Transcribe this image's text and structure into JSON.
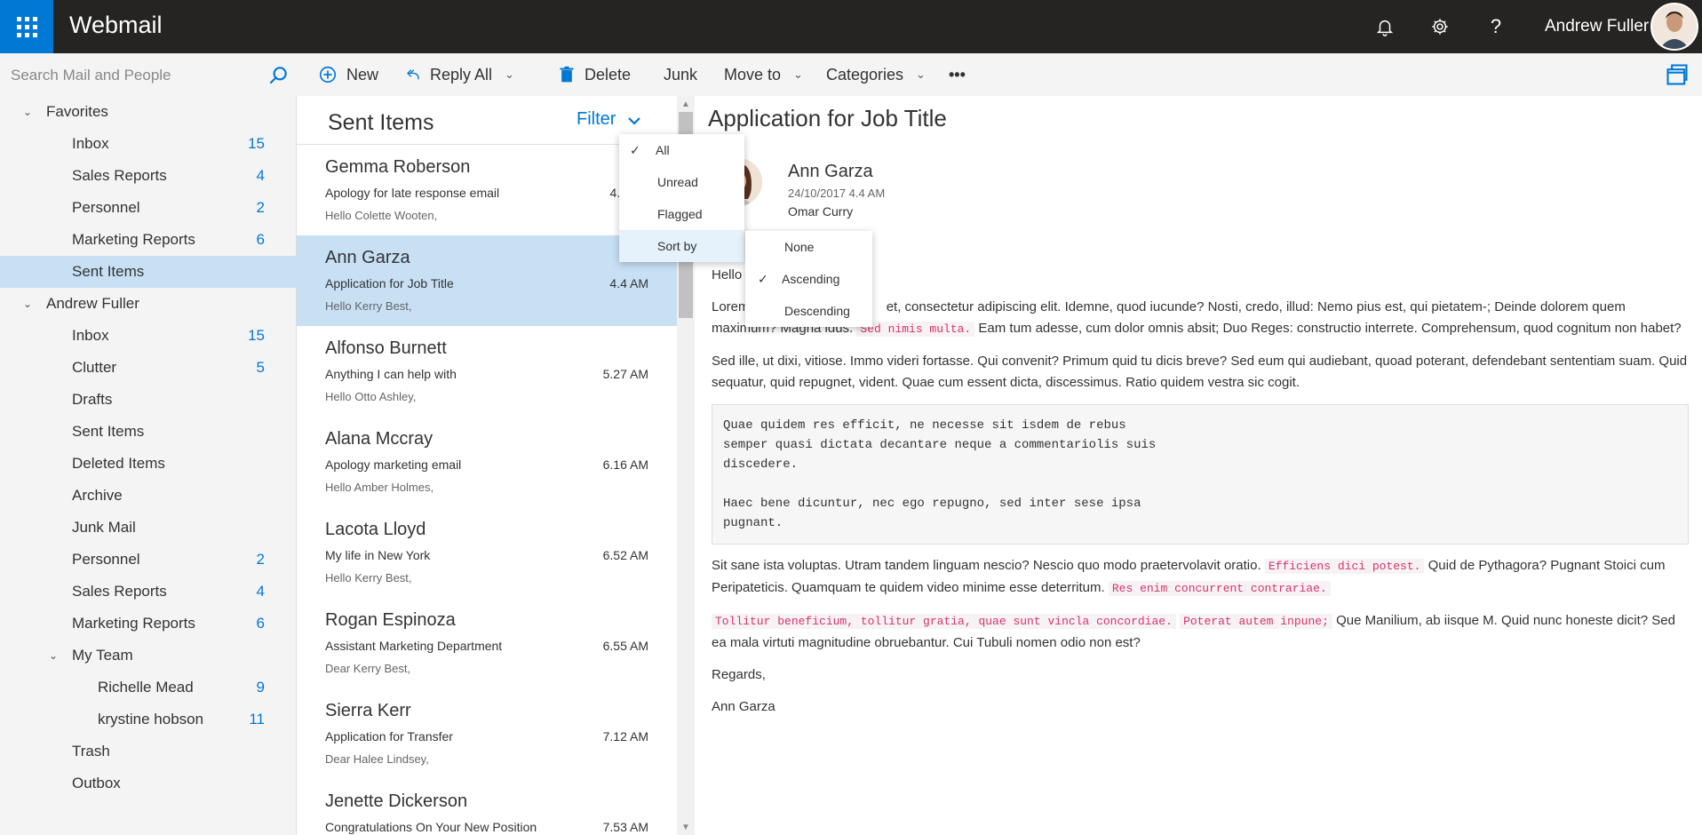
{
  "app": {
    "title": "Webmail",
    "user_name": "Andrew Fuller"
  },
  "topbar": {
    "icons": [
      "waffle-icon",
      "bell-icon",
      "gear-icon",
      "help-icon"
    ]
  },
  "search": {
    "placeholder": "Search Mail and People"
  },
  "sidebar": {
    "favorites": {
      "label": "Favorites",
      "items": [
        {
          "label": "Inbox",
          "count": "15"
        },
        {
          "label": "Sales Reports",
          "count": "4"
        },
        {
          "label": "Personnel",
          "count": "2"
        },
        {
          "label": "Marketing Reports",
          "count": "6"
        },
        {
          "label": "Sent Items",
          "count": ""
        }
      ]
    },
    "account": {
      "label": "Andrew Fuller",
      "items": [
        {
          "label": "Inbox",
          "count": "15"
        },
        {
          "label": "Clutter",
          "count": "5"
        },
        {
          "label": "Drafts",
          "count": ""
        },
        {
          "label": "Sent Items",
          "count": ""
        },
        {
          "label": "Deleted Items",
          "count": ""
        },
        {
          "label": "Archive",
          "count": ""
        },
        {
          "label": "Junk Mail",
          "count": ""
        },
        {
          "label": "Personnel",
          "count": "2"
        },
        {
          "label": "Sales Reports",
          "count": "4"
        },
        {
          "label": "Marketing Reports",
          "count": "6"
        }
      ],
      "team": {
        "label": "My Team",
        "items": [
          {
            "label": "Richelle Mead",
            "count": "9"
          },
          {
            "label": "krystine hobson",
            "count": "11"
          }
        ]
      },
      "after_team": [
        {
          "label": "Trash",
          "count": ""
        },
        {
          "label": "Outbox",
          "count": ""
        }
      ]
    }
  },
  "toolbar": {
    "new_label": "New",
    "reply_all_label": "Reply All",
    "delete_label": "Delete",
    "junk_label": "Junk",
    "move_to_label": "Move to",
    "categories_label": "Categories",
    "more_label": "•••"
  },
  "mail_list": {
    "title": "Sent Items",
    "filter_label": "Filter",
    "items": [
      {
        "sender": "Gemma Roberson",
        "subject": "Apology for late response email",
        "time": "4.3",
        "preview": "Hello Colette Wooten,"
      },
      {
        "sender": "Ann Garza",
        "subject": "Application for Job Title",
        "time": "4.4 AM",
        "preview": "Hello Kerry Best,"
      },
      {
        "sender": "Alfonso Burnett",
        "subject": "Anything I can help with",
        "time": "5.27 AM",
        "preview": "Hello Otto Ashley,"
      },
      {
        "sender": "Alana Mccray",
        "subject": "Apology marketing email",
        "time": "6.16 AM",
        "preview": "Hello Amber Holmes,"
      },
      {
        "sender": "Lacota Lloyd",
        "subject": "My life in New York",
        "time": "6.52 AM",
        "preview": "Hello Kerry Best,"
      },
      {
        "sender": "Rogan Espinoza",
        "subject": "Assistant Marketing Department",
        "time": "6.55 AM",
        "preview": "Dear Kerry Best,"
      },
      {
        "sender": "Sierra Kerr",
        "subject": "Application for Transfer",
        "time": "7.12 AM",
        "preview": "Dear Halee Lindsey,"
      },
      {
        "sender": "Jenette Dickerson",
        "subject": "Congratulations On Your New Position",
        "time": "7.53 AM",
        "preview": ""
      }
    ]
  },
  "filter_menu": {
    "items": [
      {
        "label": "All",
        "checked": "✓"
      },
      {
        "label": "Unread",
        "checked": ""
      },
      {
        "label": "Flagged",
        "checked": ""
      },
      {
        "label": "Sort by",
        "checked": ""
      }
    ],
    "sort_submenu": [
      {
        "label": "None",
        "checked": ""
      },
      {
        "label": "Ascending",
        "checked": "✓"
      },
      {
        "label": "Descending",
        "checked": ""
      }
    ]
  },
  "email": {
    "title": "Application for Job Title",
    "sender": "Ann Garza",
    "date": "24/10/2017 4.4 AM",
    "to": "Omar Curry",
    "greeting": "Hello",
    "p1_a": "Lorem",
    "p1_b": "et, consectetur adipiscing elit. Idemne, quod iucunde? Nosti, credo, illud: Nemo pius est, qui pietatem-; Deinde dolorem quem maximum? Magna ldus.",
    "p1_code": "Sed nimis multa.",
    "p1_c": "Eam tum adesse, cum dolor omnis absit; Duo Reges: constructio interrete. Comprehensum, quod cognitum non habet?",
    "p2": "Sed ille, ut dixi, vitiose. Immo videri fortasse. Qui convenit? Primum quid tu dicis breve? Sed eum qui audiebant, quoad poterant, defendebant sententiam suam. Quid sequatur, quid repugnet, vident. Quae cum essent dicta, discessimus. Ratio quidem vestra sic cogit.",
    "code_block": "Quae quidem res efficit, ne necesse sit isdem de rebus\nsemper quasi dictata decantare neque a commentariolis suis\ndiscedere.\n\nHaec bene dicuntur, nec ego repugno, sed inter sese ipsa\npugnant.",
    "p3_a": "Sit sane ista voluptas. Utram tandem linguam nescio? Nescio quo modo praetervolavit oratio.",
    "p3_code1": "Efficiens dici potest.",
    "p3_b": "Quid de Pythagora? Pugnant Stoici cum Peripateticis. Quamquam te quidem video minime esse deterritum.",
    "p3_code2": "Res enim concurrent contrariae.",
    "p4_code1": "Tollitur beneficium, tollitur gratia, quae sunt vincla concordiae.",
    "p4_code2": "Poterat autem inpune;",
    "p4_a": "Que Manilium, ab iisque M. Quid nunc honeste dicit? Sed ea mala virtuti magnitudine obruebantur. Cui Tubuli nomen odio non est?",
    "regards": "Regards,",
    "signature": "Ann Garza"
  },
  "colors": {
    "accent": "#0078d4",
    "topbar": "#252423",
    "selected": "#c7e0f4"
  }
}
